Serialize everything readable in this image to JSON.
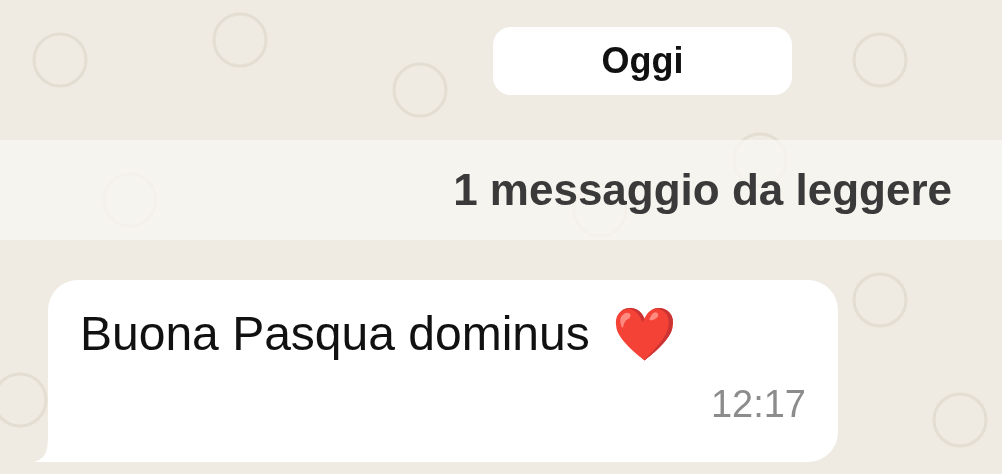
{
  "date_separator": "Oggi",
  "unread_banner": "1 messaggio da leggere",
  "messages": [
    {
      "kind": "incoming",
      "text": "Buona Pasqua dominus",
      "emoji": "❤️",
      "time": "12:17"
    }
  ]
}
